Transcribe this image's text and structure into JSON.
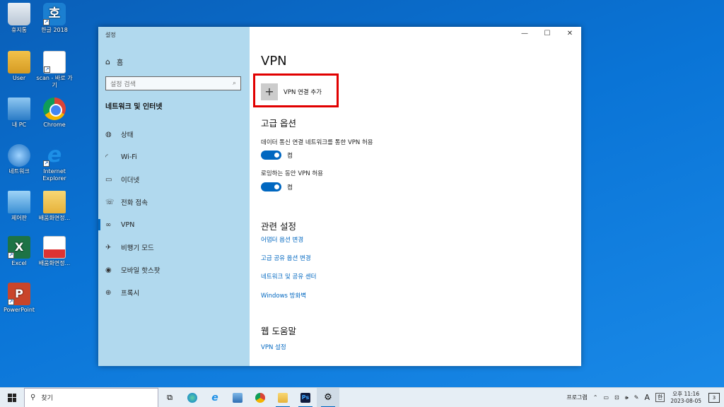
{
  "desktop": {
    "icons": [
      {
        "label": "휴지통",
        "icon": "recycle-bin-icon"
      },
      {
        "label": "한글 2018",
        "icon": "hangul-icon"
      },
      {
        "label": "User",
        "icon": "user-folder-icon"
      },
      {
        "label": "scan - 바로 가기",
        "icon": "document-icon"
      },
      {
        "label": "내 PC",
        "icon": "computer-icon"
      },
      {
        "label": "Chrome",
        "icon": "chrome-icon"
      },
      {
        "label": "네트워크",
        "icon": "network-icon"
      },
      {
        "label": "Internet Explorer",
        "icon": "ie-icon"
      },
      {
        "label": "제어판",
        "icon": "control-panel-icon"
      },
      {
        "label": "배움화면정...",
        "icon": "folder-icon"
      },
      {
        "label": "Excel",
        "icon": "excel-icon"
      },
      {
        "label": "배움화면정...",
        "icon": "pdf-icon"
      },
      {
        "label": "PowerPoint",
        "icon": "powerpoint-icon"
      }
    ]
  },
  "window": {
    "title": "설정",
    "controls": {
      "minimize": "—",
      "maximize": "☐",
      "close": "✕"
    }
  },
  "sidebar": {
    "home_label": "홈",
    "search_placeholder": "설정 검색",
    "section_title": "네트워크 및 인터넷",
    "items": [
      {
        "label": "상태",
        "icon": "globe-status-icon",
        "glyph": "◍"
      },
      {
        "label": "Wi-Fi",
        "icon": "wifi-icon",
        "glyph": "◜"
      },
      {
        "label": "이더넷",
        "icon": "ethernet-icon",
        "glyph": "▭"
      },
      {
        "label": "전화 접속",
        "icon": "dialup-icon",
        "glyph": "☏"
      },
      {
        "label": "VPN",
        "icon": "vpn-icon",
        "glyph": "∞"
      },
      {
        "label": "비행기 모드",
        "icon": "airplane-icon",
        "glyph": "✈"
      },
      {
        "label": "모바일 핫스팟",
        "icon": "hotspot-icon",
        "glyph": "◉"
      },
      {
        "label": "프록시",
        "icon": "proxy-icon",
        "glyph": "⊕"
      }
    ],
    "active_index": 4
  },
  "main": {
    "title": "VPN",
    "add_vpn_label": "VPN 연결 추가",
    "advanced_title": "고급 옵션",
    "options": [
      {
        "label": "데이터 통신 연결 네트워크를 통한 VPN 허용",
        "state": "켬",
        "on": true
      },
      {
        "label": "로밍하는 동안 VPN 허용",
        "state": "켬",
        "on": true
      }
    ],
    "related_title": "관련 설정",
    "related_links": [
      "어댑터 옵션 변경",
      "고급 공유 옵션 변경",
      "네트워크 및 공유 센터",
      "Windows 방화벽"
    ],
    "help_title": "웹 도움말",
    "help_links": [
      "VPN 설정"
    ],
    "accent_color": "#0067c0",
    "highlight_color": "#e10000"
  },
  "taskbar": {
    "search_placeholder": "찾기",
    "tray_label": "프로그램",
    "tray_lang": "한",
    "tray_ime": "A",
    "time_period": "오후 11:16",
    "date": "2023-08-05",
    "notifications": "3"
  }
}
